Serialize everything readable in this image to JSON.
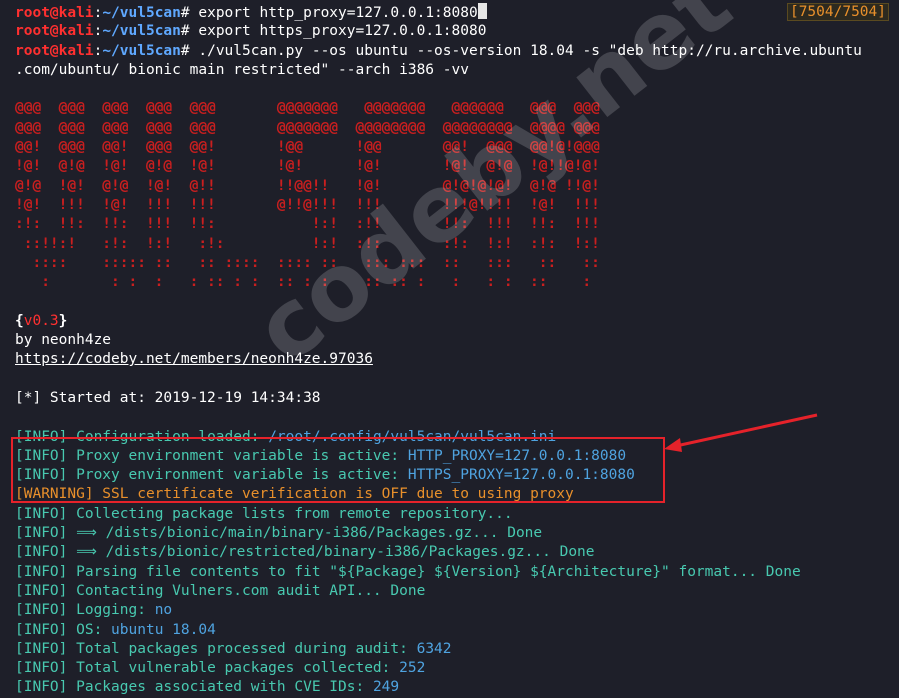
{
  "prompt": {
    "user": "root@kali",
    "sep": ":",
    "path": "~/vul5can",
    "symbol": "#"
  },
  "counter": "[7504/7504]",
  "commands": [
    "export http_proxy=127.0.0.1:8080",
    "export https_proxy=127.0.0.1:8080",
    "./vul5can.py --os ubuntu --os-version 18.04 -s \"deb http://ru.archive.ubuntu"
  ],
  "command_wrap": ".com/ubuntu/ bionic main restricted\" --arch i386 -vv",
  "banner": [
    "@@@  @@@  @@@  @@@  @@@       @@@@@@@   @@@@@@@   @@@@@@   @@@  @@@",
    "@@@  @@@  @@@  @@@  @@@       @@@@@@@  @@@@@@@@  @@@@@@@@  @@@@ @@@",
    "@@!  @@@  @@!  @@@  @@!       !@@      !@@       @@!  @@@  @@!@!@@@",
    "!@!  @!@  !@!  @!@  !@!       !@!      !@!       !@!  @!@  !@!!@!@!",
    "@!@  !@!  @!@  !@!  @!!       !!@@!!   !@!       @!@!@!@!  @!@ !!@!",
    "!@!  !!!  !@!  !!!  !!!       @!!@!!!  !!!       !!!@!!!!  !@!  !!!",
    ":!:  !!:  !!:  !!!  !!:           !:!  :!!       !!:  !!!  !!:  !!!",
    " ::!!:!   :!:  !:!   :!:          !:!  :!:       :!:  !:!  :!:  !:!",
    "  ::::    ::::: ::   :: ::::  :::: ::   ::: :::  ::   :::   ::   ::",
    "   :       : :  :   : :: : :  :: : :    :: :: :   :   : :  ::    :"
  ],
  "version": "v0.3",
  "author": "by neonh4ze",
  "url": "https://codeby.net/members/neonh4ze.97036",
  "started": "[*] Started at: 2019-12-19 14:34:38",
  "log": [
    {
      "tag": "[INFO]",
      "text": " Configuration loaded: ",
      "value": "/root/.config/vul5can/vul5can.ini",
      "tail": ""
    },
    {
      "tag": "[INFO]",
      "text": " Proxy environment variable is active: ",
      "value": "HTTP_PROXY=127.0.0.1:8080",
      "tail": ""
    },
    {
      "tag": "[INFO]",
      "text": " Proxy environment variable is active: ",
      "value": "HTTPS_PROXY=127.0.0.1:8080",
      "tail": ""
    },
    {
      "tag": "[WARNING]",
      "text": " SSL certificate verification is OFF due to using proxy",
      "value": "",
      "tail": ""
    },
    {
      "tag": "[INFO]",
      "text": " Collecting package lists from remote repository...",
      "value": "",
      "tail": ""
    },
    {
      "tag": "[INFO]",
      "text": " ⟹ /dists/bionic/main/binary-i386/Packages.gz... ",
      "value": "",
      "tail": "Done"
    },
    {
      "tag": "[INFO]",
      "text": " ⟹ /dists/bionic/restricted/binary-i386/Packages.gz... ",
      "value": "",
      "tail": "Done"
    },
    {
      "tag": "[INFO]",
      "text": " Parsing file contents to fit \"${Package} ${Version} ${Architecture}\" format... ",
      "value": "",
      "tail": "Done"
    },
    {
      "tag": "[INFO]",
      "text": " Contacting Vulners.com audit API... ",
      "value": "",
      "tail": "Done"
    },
    {
      "tag": "[INFO]",
      "text": " Logging: ",
      "value": "no",
      "tail": ""
    },
    {
      "tag": "[INFO]",
      "text": " OS: ",
      "value": "ubuntu 18.04",
      "tail": ""
    },
    {
      "tag": "[INFO]",
      "text": " Total packages processed during audit: ",
      "value": "6342",
      "tail": ""
    },
    {
      "tag": "[INFO]",
      "text": " Total vulnerable packages collected: ",
      "value": "252",
      "tail": ""
    },
    {
      "tag": "[INFO]",
      "text": " Packages associated with CVE IDs: ",
      "value": "249",
      "tail": ""
    }
  ],
  "watermark": "codeby.net",
  "colors": {
    "user": "#ff3030",
    "path": "#5fa8ff",
    "info": "#48c9b0",
    "value": "#4fa3e0",
    "warning": "#e9902b",
    "banner": "#c91f1f",
    "annotation": "#e5222a"
  }
}
